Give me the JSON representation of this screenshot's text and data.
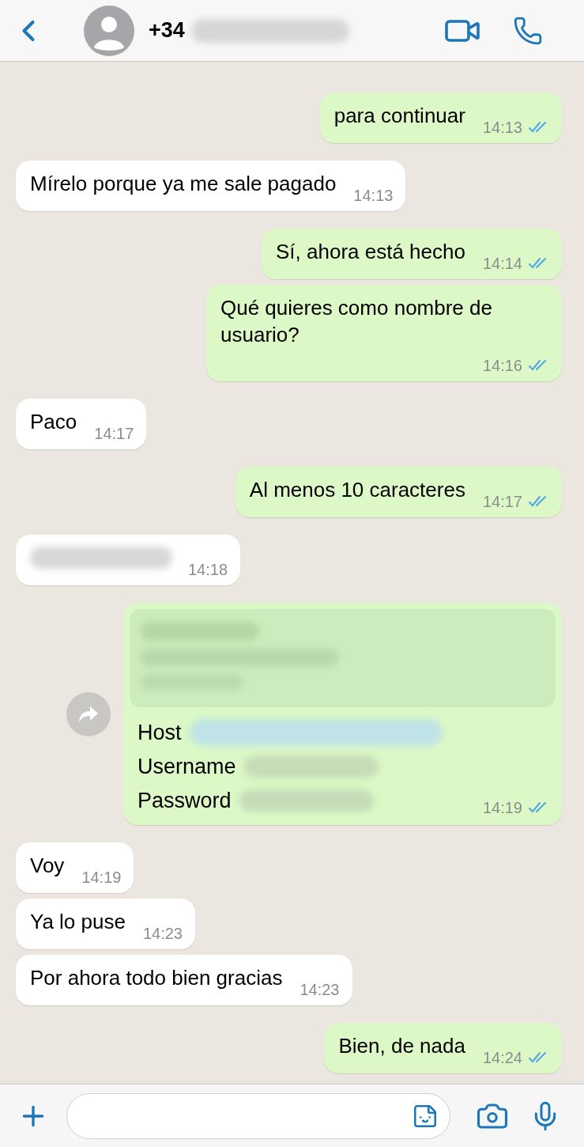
{
  "header": {
    "contact_name": "+34"
  },
  "messages": [
    {
      "kind": "text",
      "outgoing": true,
      "text": "para continuar",
      "time": "14:13",
      "read": true
    },
    {
      "kind": "text",
      "outgoing": false,
      "text": "Mírelo porque ya me sale pagado",
      "time": "14:13"
    },
    {
      "kind": "text",
      "outgoing": true,
      "text": "Sí, ahora está hecho",
      "time": "14:14",
      "read": true
    },
    {
      "kind": "text",
      "outgoing": true,
      "text": "Qué quieres como nombre de usuario?",
      "time": "14:16",
      "read": true
    },
    {
      "kind": "text",
      "outgoing": false,
      "text": "Paco",
      "time": "14:17"
    },
    {
      "kind": "text",
      "outgoing": true,
      "text": "Al menos 10 caracteres",
      "time": "14:17",
      "read": true
    },
    {
      "kind": "redacted",
      "outgoing": false,
      "time": "14:18"
    },
    {
      "kind": "credentials",
      "outgoing": true,
      "fields": [
        {
          "label": "Host"
        },
        {
          "label": "Username"
        },
        {
          "label": "Password"
        }
      ],
      "time": "14:19",
      "read": true
    },
    {
      "kind": "text",
      "outgoing": false,
      "text": "Voy",
      "time": "14:19"
    },
    {
      "kind": "text",
      "outgoing": false,
      "text": "Ya lo puse",
      "time": "14:23"
    },
    {
      "kind": "text",
      "outgoing": false,
      "text": "Por ahora todo bien gracias",
      "time": "14:23"
    },
    {
      "kind": "text",
      "outgoing": true,
      "text": "Bien, de nada",
      "time": "14:24",
      "read": true
    }
  ]
}
